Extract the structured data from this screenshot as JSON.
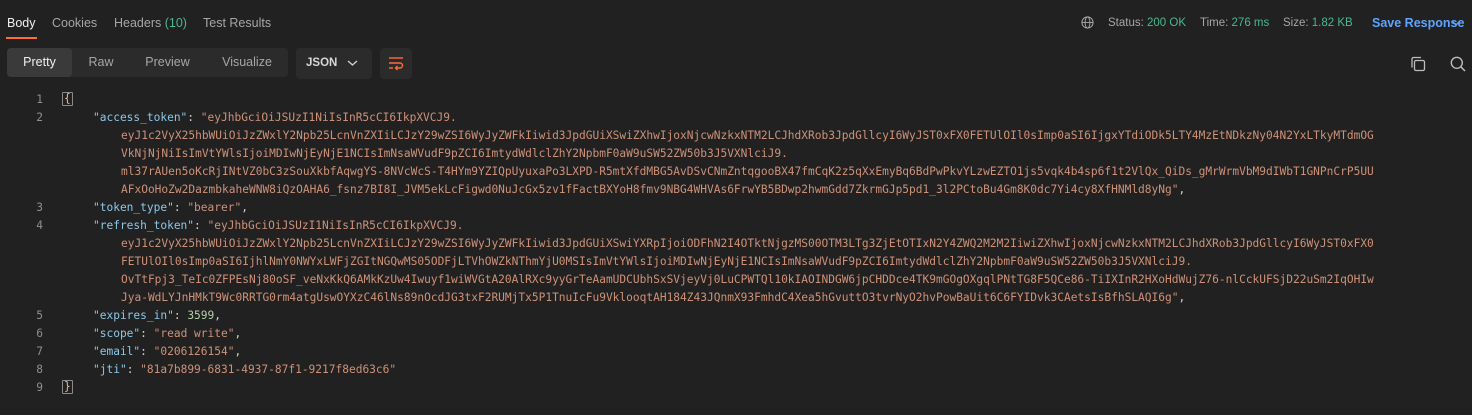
{
  "tabs": [
    {
      "label": "Body"
    },
    {
      "label": "Cookies"
    },
    {
      "label": "Headers",
      "count": "(10)"
    },
    {
      "label": "Test Results"
    }
  ],
  "response": {
    "status_label": "Status:",
    "status_value": "200 OK",
    "time_label": "Time:",
    "time_value": "276 ms",
    "size_label": "Size:",
    "size_value": "1.82 KB",
    "save_label": "Save Response"
  },
  "views": [
    "Pretty",
    "Raw",
    "Preview",
    "Visualize"
  ],
  "format": "JSON",
  "line_numbers": [
    "1",
    "2",
    "3",
    "4",
    "5",
    "6",
    "7",
    "8",
    "9"
  ],
  "code": {
    "open": "{",
    "close": "}",
    "access_token_key": "\"access_token\"",
    "access_token_v1": "\"eyJhbGciOiJSUzI1NiIsInR5cCI6IkpXVCJ9.",
    "access_token_v2": "eyJ1c2VyX25hbWUiOiJzZWxlY2Npb25LcnVnZXIiLCJzY29wZSI6WyJyZWFkIiwid3JpdGUiXSwiZXhwIjoxNjcwNzkxNTM2LCJhdXRob3JpdGllcyI6WyJST0xFX0FETUlOIl0sImp0aSI6IjgxYTdiODk5LTY4MzEtNDkzNy04N2YxLTkyMTdmOG",
    "access_token_v3": "VkNjNjNiIsImVtYWlsIjoiMDIwNjEyNjE1NCIsImNsaWVudF9pZCI6ImtydWdlclZhY2NpbmF0aW9uSW52ZW50b3J5VXNlciJ9.",
    "access_token_v4": "ml37rAUen5oKcRjINtVZ0bC3zSouXkbfAqwgYS-8NVcWcS-T4HYm9YZIQpUyuxaPo3LXPD-R5mtXfdMBG5AvDSvCNmZntqgooBX47fmCqK2z5qXxEmyBq6BdPwPkvYLzwEZTO1js5vqk4b4sp6f1t2VlQx_QiDs_gMrWrmVbM9dIWbT1GNPnCrP5UU",
    "access_token_v5": "AFxOoHoZw2DazmbkaheWNW8iQzOAHA6_fsnz7BI8I_JVM5ekLcFigwd0NuJcGx5zv1fFactBXYoH8fmv9NBG4WHVAs6FrwYB5BDwp2hwmGdd7ZkrmGJp5pd1_3l2PCtoBu4Gm8K0dc7Yi4cy8XfHNMld8yNg\"",
    "token_type_key": "\"token_type\"",
    "token_type_val": "\"bearer\"",
    "refresh_token_key": "\"refresh_token\"",
    "refresh_token_v1": "\"eyJhbGciOiJSUzI1NiIsInR5cCI6IkpXVCJ9.",
    "refresh_token_v2": "eyJ1c2VyX25hbWUiOiJzZWxlY2Npb25LcnVnZXIiLCJzY29wZSI6WyJyZWFkIiwid3JpdGUiXSwiYXRpIjoiODFhN2I4OTktNjgzMS00OTM3LTg3ZjEtOTIxN2Y4ZWQ2M2M2IiwiZXhwIjoxNjcwNzkxNTM2LCJhdXRob3JpdGllcyI6WyJST0xFX0",
    "refresh_token_v3": "FETUlOIl0sImp0aSI6IjhlNmY0NWYxLWFjZGItNGQwMS05ODFjLTVhOWZkNThmYjU0MSIsImVtYWlsIjoiMDIwNjEyNjE1NCIsImNsaWVudF9pZCI6ImtydWdlclZhY2NpbmF0aW9uSW52ZW50b3J5VXNlciJ9.",
    "refresh_token_v4": "OvTtFpj3_TeIc0ZFPEsNj80oSF_veNxKkQ6AMkKzUw4Iwuyf1wiWVGtA20AlRXc9yyGrTeAamUDCUbhSxSVjeyVj0LuCPWTQl10kIAOINDGW6jpCHDDce4TK9mGOgOXgqlPNtTG8F5QCe86-TiIXInR2HXoHdWujZ76-nlCckUFSjD22uSm2IqOHIw",
    "refresh_token_v5": "Jya-WdLYJnHMkT9Wc0RRTG0rm4atgUswOYXzC46lNs89nOcdJG3txF2RUMjTx5P1TnuIcFu9VklooqtAH184Z43JQnmX93FmhdC4Xea5hGvuttO3tvrNyO2hvPowBaUit6C6FYIDvk3CAetsIsBfhSLAQI6g\"",
    "expires_in_key": "\"expires_in\"",
    "expires_in_val": "3599",
    "scope_key": "\"scope\"",
    "scope_val": "\"read write\"",
    "email_key": "\"email\"",
    "email_val": "\"0206126154\"",
    "jti_key": "\"jti\"",
    "jti_val": "\"81a7b899-6831-4937-87f1-9217f8ed63c6\""
  },
  "icons": [
    "globe-icon",
    "chevron-down-icon",
    "wrap-lines-icon",
    "copy-icon",
    "search-icon"
  ],
  "colors": {
    "accent": "#ff6c37",
    "status_ok": "#49b98e",
    "save": "#5fa3ff",
    "string": "#ce9178",
    "key": "#8cc7e8"
  }
}
